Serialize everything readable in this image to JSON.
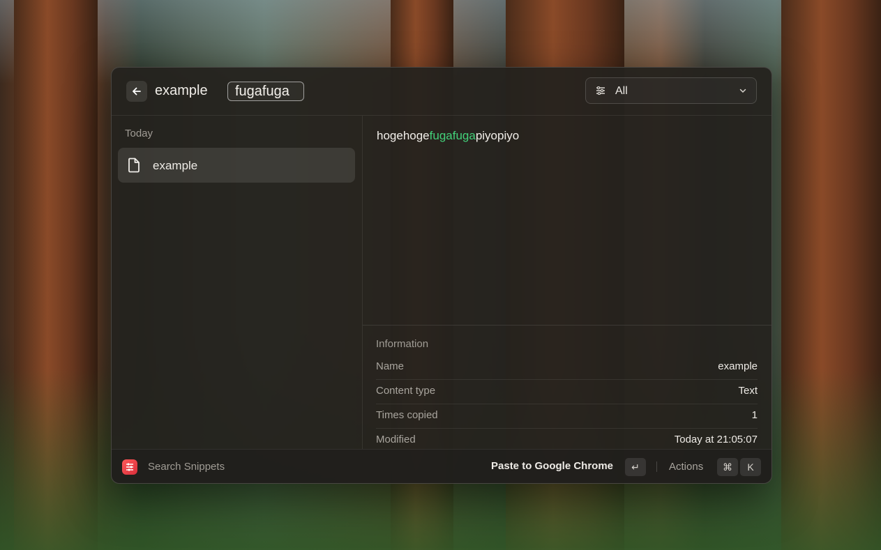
{
  "header": {
    "back_icon": "arrow-left-icon",
    "title": "example",
    "search_value": "fugafuga",
    "filter": {
      "icon": "filter-lines-icon",
      "label": "All",
      "chevron": "chevron-down-icon"
    }
  },
  "list": {
    "section_title": "Today",
    "items": [
      {
        "icon": "document-icon",
        "label": "example"
      }
    ]
  },
  "preview": {
    "before": "hogehoge",
    "highlight": "fugafuga",
    "after": "piyopiyo",
    "highlight_color": "#43d17a"
  },
  "info": {
    "title": "Information",
    "rows": [
      {
        "key": "Name",
        "value": "example"
      },
      {
        "key": "Content type",
        "value": "Text"
      },
      {
        "key": "Times copied",
        "value": "1"
      },
      {
        "key": "Modified",
        "value": "Today at 21:05:07"
      }
    ]
  },
  "footer": {
    "app_icon": "snippets-app-icon",
    "app_name": "Search Snippets",
    "primary_action": "Paste to Google Chrome",
    "primary_key": "↵",
    "actions_label": "Actions",
    "actions_keys": [
      "⌘",
      "K"
    ]
  }
}
